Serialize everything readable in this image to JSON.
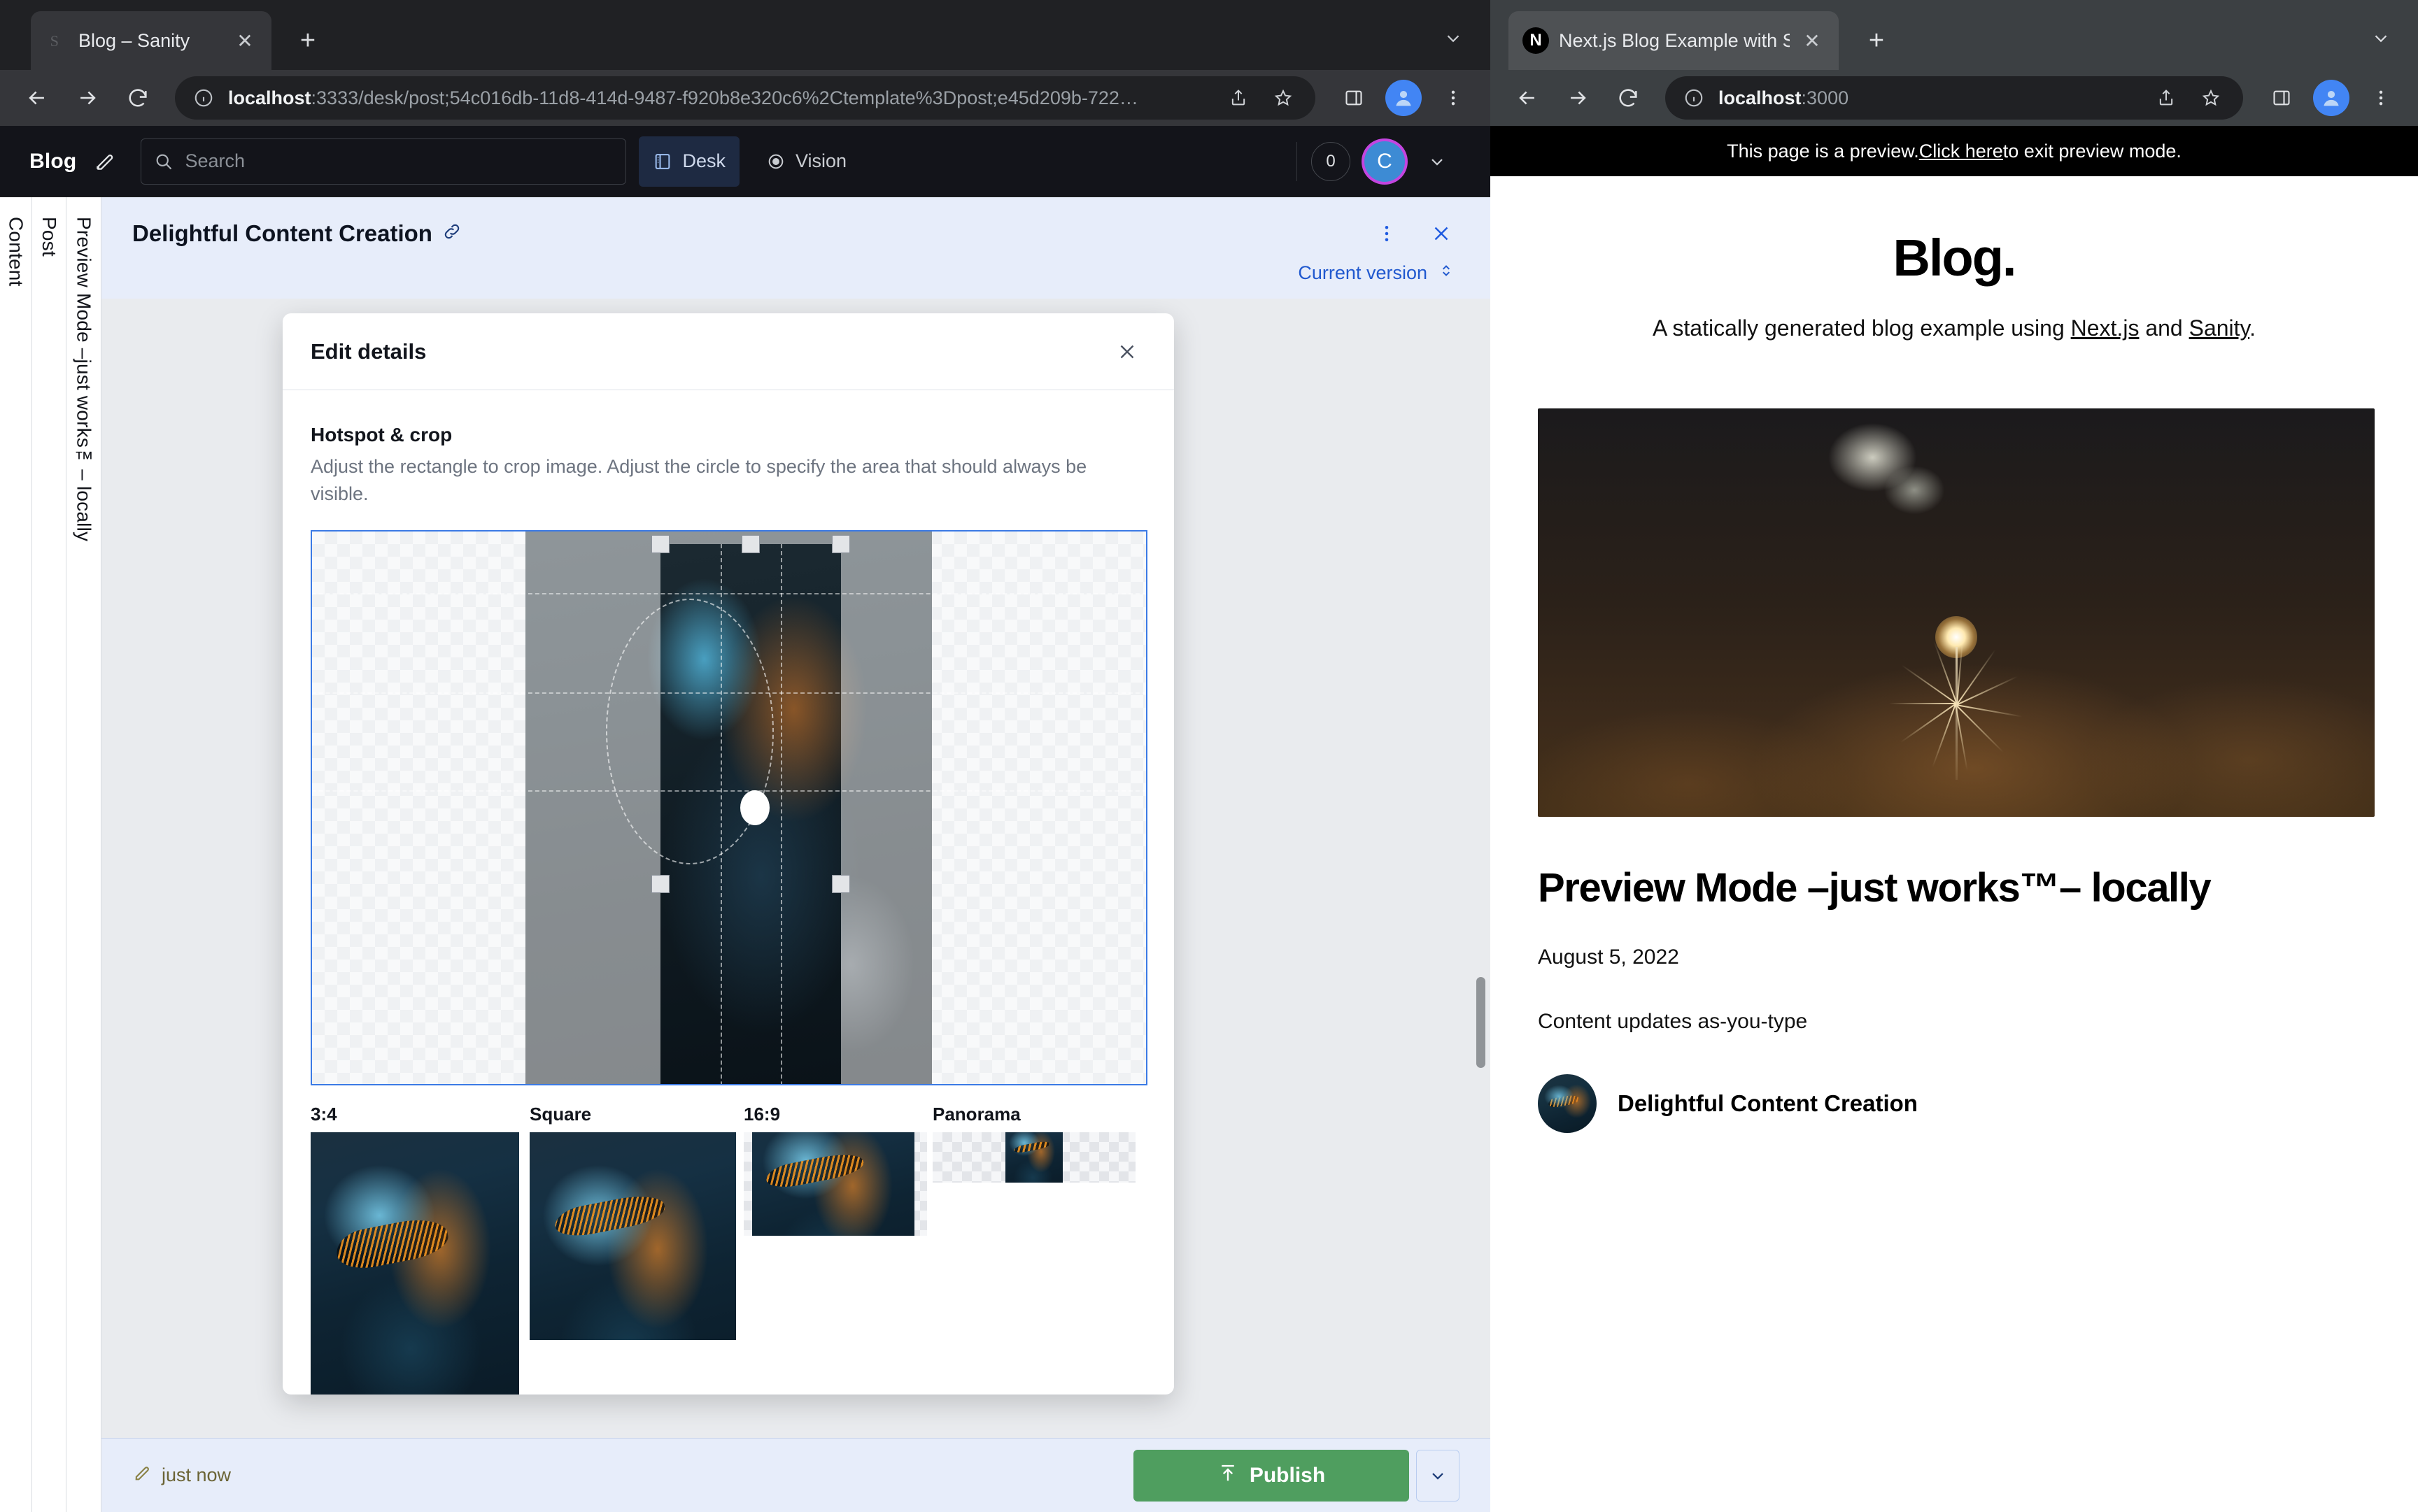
{
  "left_browser": {
    "tab": {
      "title": "Blog – Sanity",
      "favicon": "sanity-s-icon",
      "close_label": "✕"
    },
    "new_tab_label": "+",
    "nav": {
      "back": "←",
      "forward": "→",
      "reload": "⟳"
    },
    "omnibox": {
      "info_icon": "info-circle-icon",
      "url_host": "localhost",
      "url_path": ":3333/desk/post;54c016db-11d8-414d-9487-f920b8e320c6%2Ctemplate%3Dpost;e45d209b-722…",
      "share_icon": "share-icon",
      "bookmark_icon": "star-icon"
    },
    "toolbar_right": {
      "side_panel_icon": "side-panel-icon",
      "profile_icon": "profile-avatar-icon",
      "menu_icon": "three-dot-menu-icon"
    }
  },
  "sanity": {
    "logo": "Blog",
    "edit_icon": "compose-icon",
    "search": {
      "placeholder": "Search",
      "icon": "search-icon"
    },
    "tabs": [
      {
        "label": "Desk",
        "icon": "desk-icon",
        "active": true
      },
      {
        "label": "Vision",
        "icon": "eye-icon",
        "active": false
      }
    ],
    "presence_count": "0",
    "user_initial": "C",
    "user_chevron": "chevron-down-icon",
    "panes": [
      {
        "label": "Content"
      },
      {
        "label": "Post"
      },
      {
        "label": "Preview Mode –just works™– locally"
      }
    ],
    "document": {
      "title": "Delightful Content Creation",
      "link_icon": "link-icon",
      "menu_icon": "three-dot-menu-icon",
      "close_icon": "close-icon",
      "version_label": "Current version",
      "version_chevron": "chevron-up-down-icon"
    },
    "modal": {
      "title": "Edit details",
      "close_icon": "close-icon",
      "section_title": "Hotspot & crop",
      "section_desc": "Adjust the rectangle to crop image. Adjust the circle to specify the area that should always be visible.",
      "aspects": [
        {
          "label": "3:4"
        },
        {
          "label": "Square"
        },
        {
          "label": "16:9"
        },
        {
          "label": "Panorama"
        }
      ]
    },
    "footer": {
      "edited_icon": "pencil-icon",
      "edited_label": "just now",
      "publish_label": "Publish",
      "publish_icon": "publish-up-arrow-icon",
      "publish_chevron": "chevron-down-icon"
    }
  },
  "right_browser": {
    "tab": {
      "title": "Next.js Blog Example with Sanity",
      "favicon": "nextjs-n-icon",
      "close_label": "✕"
    },
    "new_tab_label": "+",
    "nav": {
      "back": "←",
      "forward": "→",
      "reload": "⟳"
    },
    "omnibox": {
      "info_icon": "info-circle-icon",
      "url_host": "localhost",
      "url_path": ":3000",
      "share_icon": "share-icon",
      "bookmark_icon": "star-icon"
    },
    "toolbar_right": {
      "side_panel_icon": "side-panel-icon",
      "profile_icon": "profile-avatar-icon",
      "menu_icon": "three-dot-menu-icon"
    }
  },
  "preview": {
    "banner": {
      "before": "This page is a preview. ",
      "link": "Click here",
      "after": " to exit preview mode."
    },
    "site_title": "Blog.",
    "tagline_before": "A statically generated blog example using ",
    "tagline_link1": "Next.js",
    "tagline_mid": " and ",
    "tagline_link2": "Sanity",
    "tagline_after": ".",
    "hero_alt": "sparkler-in-forest-photo",
    "post_title": "Preview Mode –just works™– locally",
    "post_date": "August 5, 2022",
    "post_excerpt": "Content updates as-you-type",
    "author_name": "Delightful Content Creation",
    "author_avatar_alt": "author-portrait-avatar"
  },
  "colors": {
    "accent_blue": "#3b7ae5",
    "publish_green": "#4f9e5f",
    "header_blue_bg": "#e7edfa",
    "chrome_dark": "#202124",
    "presence_purple": "#c445e0"
  }
}
